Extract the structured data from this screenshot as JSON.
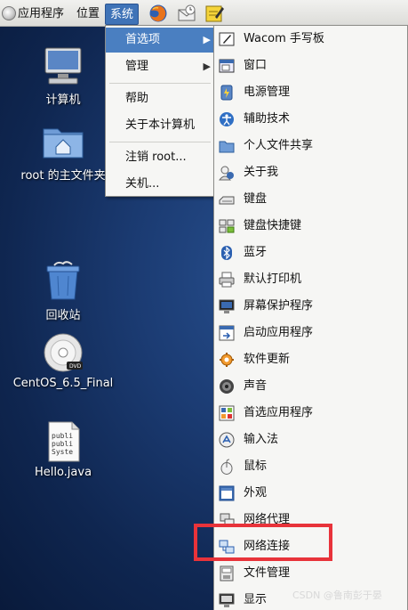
{
  "panel": {
    "apps_label": "应用程序",
    "places_label": "位置",
    "system_label": "系统",
    "launchers": [
      "firefox-icon",
      "mail-icon",
      "note-icon"
    ]
  },
  "desktop": {
    "icons": [
      {
        "label": "计算机",
        "icon": "computer-icon"
      },
      {
        "label": "root 的主文件夹",
        "icon": "home-folder-icon"
      },
      {
        "label": "回收站",
        "icon": "trash-icon"
      },
      {
        "label": "CentOS_6.5_Final",
        "icon": "dvd-icon"
      },
      {
        "label": "Hello.java",
        "icon": "text-file-icon",
        "preview_lines": [
          "publi",
          "publi",
          "Syste"
        ]
      }
    ]
  },
  "system_menu": {
    "items": [
      {
        "label": "首选项",
        "has_submenu": true,
        "selected": true
      },
      {
        "label": "管理",
        "has_submenu": true
      },
      {
        "label": "帮助"
      },
      {
        "label": "关于本计算机"
      },
      {
        "label": "注销 root..."
      },
      {
        "label": "关机..."
      }
    ]
  },
  "preferences_menu": {
    "items": [
      {
        "label": "Wacom 手写板",
        "icon": "tablet-icon"
      },
      {
        "label": "窗口",
        "icon": "window-icon"
      },
      {
        "label": "电源管理",
        "icon": "power-icon"
      },
      {
        "label": "辅助技术",
        "icon": "accessibility-icon"
      },
      {
        "label": "个人文件共享",
        "icon": "folder-share-icon"
      },
      {
        "label": "关于我",
        "icon": "about-me-icon"
      },
      {
        "label": "键盘",
        "icon": "keyboard-icon"
      },
      {
        "label": "键盘快捷键",
        "icon": "keyboard-shortcuts-icon"
      },
      {
        "label": "蓝牙",
        "icon": "bluetooth-icon"
      },
      {
        "label": "默认打印机",
        "icon": "printer-icon"
      },
      {
        "label": "屏幕保护程序",
        "icon": "screensaver-icon"
      },
      {
        "label": "启动应用程序",
        "icon": "startup-icon"
      },
      {
        "label": "软件更新",
        "icon": "software-update-icon"
      },
      {
        "label": "声音",
        "icon": "sound-icon"
      },
      {
        "label": "首选应用程序",
        "icon": "preferred-apps-icon"
      },
      {
        "label": "输入法",
        "icon": "input-method-icon"
      },
      {
        "label": "鼠标",
        "icon": "mouse-icon"
      },
      {
        "label": "外观",
        "icon": "appearance-icon"
      },
      {
        "label": "网络代理",
        "icon": "network-proxy-icon"
      },
      {
        "label": "网络连接",
        "icon": "network-connections-icon",
        "highlighted": true
      },
      {
        "label": "文件管理",
        "icon": "file-management-icon"
      },
      {
        "label": "显示",
        "icon": "display-icon"
      }
    ]
  },
  "colors": {
    "menu_selection": "#4a7fc1",
    "highlight_box": "#e8333a",
    "desktop_bg": "#1b3b72"
  },
  "watermark": "CSDN @鲁南彭于晏"
}
